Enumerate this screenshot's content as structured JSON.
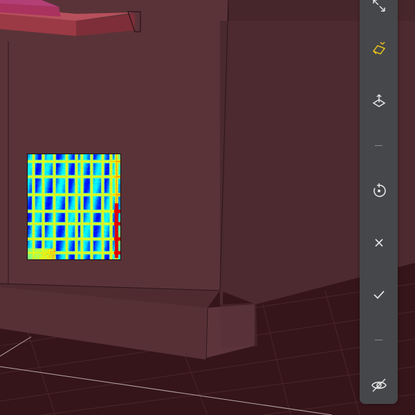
{
  "viewport": {
    "background": "#3a1e22",
    "wall_color": "#5a3338",
    "floor_color": "#351519",
    "scan_colormap": "jet"
  },
  "toolbar": {
    "background": "#46474a",
    "icon_color": "#e6e6e6",
    "active_color": "#e8c21a",
    "tools": [
      {
        "name": "expand-tool",
        "icon": "expand-arrows-icon",
        "active": false
      },
      {
        "name": "plane-select-tool",
        "icon": "plane-select-icon",
        "active": true
      },
      {
        "name": "transform-gizmo-tool",
        "icon": "axis-gizmo-icon",
        "active": false
      },
      {
        "name": "reset-tool",
        "icon": "reset-circle-icon",
        "active": false
      },
      {
        "name": "cancel-tool",
        "icon": "close-icon",
        "active": false
      },
      {
        "name": "confirm-tool",
        "icon": "check-icon",
        "active": false
      },
      {
        "name": "visibility-tool",
        "icon": "eye-hidden-icon",
        "active": false
      }
    ]
  }
}
